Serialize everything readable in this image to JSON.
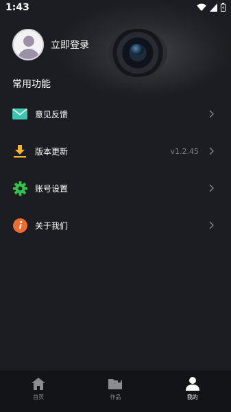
{
  "status_bar": {
    "time": "1:43"
  },
  "profile": {
    "login_label": "立即登录"
  },
  "section": {
    "title": "常用功能"
  },
  "menu": {
    "items": [
      {
        "label": "意见反馈",
        "value": "",
        "icon": "mail-icon",
        "color": "#3cc6b0"
      },
      {
        "label": "版本更新",
        "value": "v1.2.45",
        "icon": "download-icon",
        "color": "#f6b626"
      },
      {
        "label": "账号设置",
        "value": "",
        "icon": "gear-icon",
        "color": "#33c44d"
      },
      {
        "label": "关于我们",
        "value": "",
        "icon": "info-icon",
        "color": "#f16b2e"
      }
    ]
  },
  "tabs": [
    {
      "label": "首页",
      "icon": "home-icon"
    },
    {
      "label": "作品",
      "icon": "folder-icon"
    },
    {
      "label": "我的",
      "icon": "user-icon",
      "active": true
    }
  ],
  "colors": {
    "background": "#1c1d22",
    "tabbar": "#131417",
    "muted": "#7e8088"
  }
}
